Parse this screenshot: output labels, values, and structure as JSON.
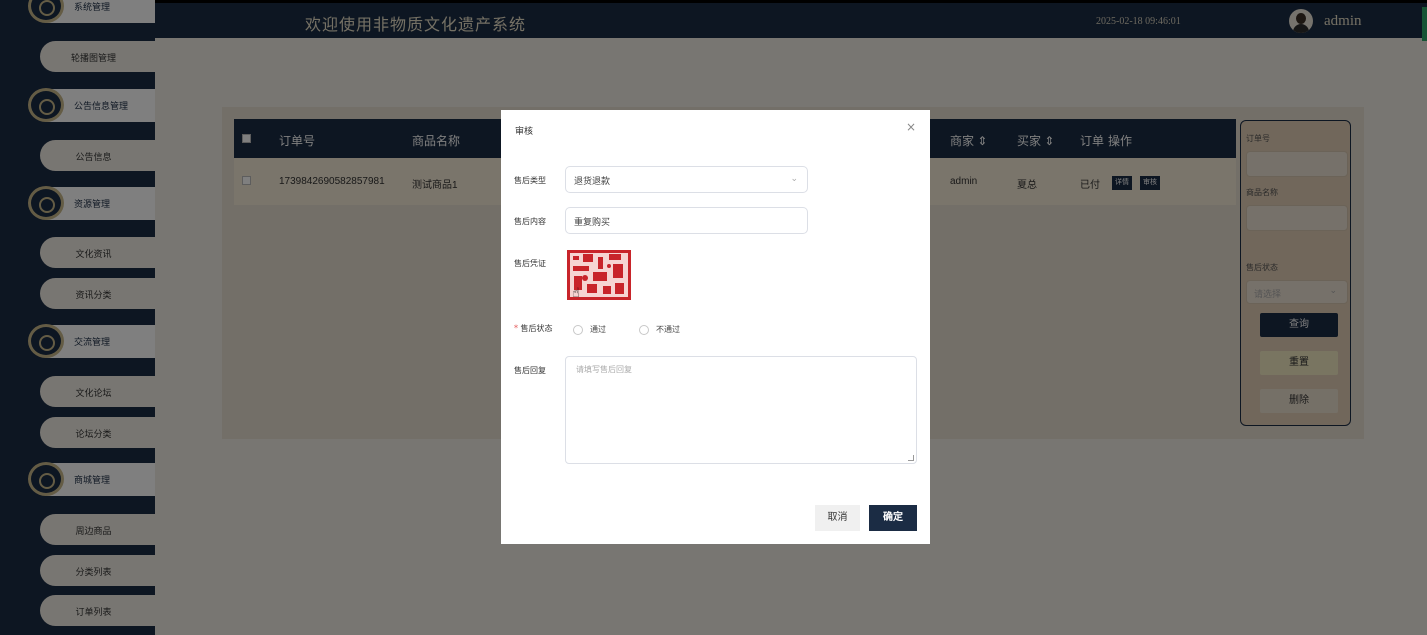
{
  "header": {
    "title": "欢迎使用非物质文化遗产系统",
    "datetime": "2025-02-18 09:46:01",
    "username": "admin"
  },
  "sidebar": {
    "groups": [
      {
        "label": "系统管理",
        "items": [
          "轮播图管理"
        ]
      },
      {
        "label": "公告信息管理",
        "items": [
          "公告信息"
        ]
      },
      {
        "label": "资源管理",
        "items": [
          "文化资讯",
          "资讯分类"
        ]
      },
      {
        "label": "交流管理",
        "items": [
          "文化论坛",
          "论坛分类"
        ]
      },
      {
        "label": "商城管理",
        "items": [
          "周边商品",
          "分类列表",
          "订单列表"
        ]
      }
    ]
  },
  "table": {
    "headers": {
      "order_no": "订单号",
      "product": "商品名称",
      "merchant": "商家 ⇕",
      "buyer": "买家 ⇕",
      "order": "订单",
      "actions": "操作"
    },
    "rows": [
      {
        "order_no": "1739842690582857981",
        "product": "测试商品1",
        "merchant": "admin",
        "buyer": "夏总",
        "status": "已付",
        "detail_label": "详情",
        "review_label": "审核"
      }
    ]
  },
  "search": {
    "order_label": "订单号",
    "product_label": "商品名称",
    "status_label": "售后状态",
    "status_placeholder": "请选择",
    "query_label": "查询",
    "reset_label": "重置",
    "delete_label": "删除",
    "query_color": "#1b2c44",
    "reset_color": "#f2eac3"
  },
  "dialog": {
    "title": "审核",
    "close": "×",
    "type_label": "售后类型",
    "type_value": "退货退款",
    "content_label": "售后内容",
    "content_value": "重复购买",
    "proof_label": "售后凭证",
    "status_label": "售后状态",
    "status_required": "*",
    "options": [
      "通过",
      "不通过"
    ],
    "reply_label": "售后回复",
    "reply_placeholder": "请填写售后回复",
    "cancel_label": "取消",
    "confirm_label": "确定"
  },
  "colors": {
    "primary": "#1b2c44",
    "accent": "#c9b98a",
    "seal_red": "#c8242a"
  }
}
